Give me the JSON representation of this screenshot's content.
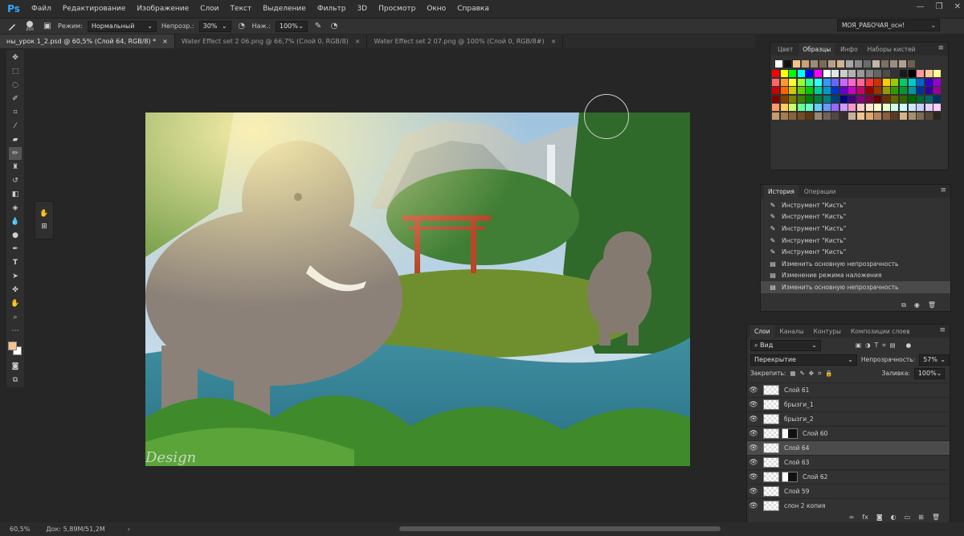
{
  "app": {
    "logo": "Ps"
  },
  "menu": [
    "Файл",
    "Редактирование",
    "Изображение",
    "Слои",
    "Текст",
    "Выделение",
    "Фильтр",
    "3D",
    "Просмотр",
    "Окно",
    "Справка"
  ],
  "window_controls": [
    "—",
    "❐",
    "✕"
  ],
  "options": {
    "brush_size": "200",
    "mode_label": "Режим:",
    "mode_value": "Нормальный",
    "opacity_label": "Непрозр.:",
    "opacity_value": "30%",
    "flow_label": "Наж.:",
    "flow_value": "100%",
    "workspace": "МОЯ_РАБОЧАЯ_осн!"
  },
  "tabs": [
    {
      "label": "ны_урок 1_2.psd @ 60,5% (Слой 64, RGB/8) *",
      "active": true
    },
    {
      "label": "Water Effect set 2 06.png @ 66,7% (Слой 0, RGB/8)",
      "active": false
    },
    {
      "label": "Water Effect set 2 07.png @ 100% (Слой 0, RGB/8#)",
      "active": false
    }
  ],
  "tab_close": "×",
  "canvas": {
    "watermark": "Design"
  },
  "swatches_panel": {
    "tabs": [
      "Цвет",
      "Образцы",
      "Инфо",
      "Наборы кистей"
    ],
    "active_tab": "Образцы",
    "recent": [
      "#ffffff",
      "#111111",
      "#f3c48f",
      "#c9a27a",
      "#9c8b7a",
      "#7a6a55",
      "#b79f86",
      "#d1b48e",
      "#a8a8a8",
      "#8a8a8a",
      "#6b6b6b",
      "#c0b8a8",
      "#7c7060",
      "#9a8f80",
      "#b0a090",
      "#6d5f4f"
    ],
    "grid": [
      "#ff0000",
      "#ffff00",
      "#00ff00",
      "#00ffff",
      "#0000ff",
      "#ff00ff",
      "#ffffff",
      "#e6e6e6",
      "#cccccc",
      "#b3b3b3",
      "#999999",
      "#808080",
      "#666666",
      "#4d4d4d",
      "#333333",
      "#1a1a1a",
      "#000000",
      "#ff9999",
      "#ffcc99",
      "#ffff99",
      "#ff6666",
      "#ff9933",
      "#ffff33",
      "#99ff33",
      "#33ff99",
      "#33ffff",
      "#3399ff",
      "#6666ff",
      "#cc66ff",
      "#ff66cc",
      "#ff6699",
      "#ff3333",
      "#cc3300",
      "#ffcc00",
      "#99cc00",
      "#00cc66",
      "#00cccc",
      "#0066cc",
      "#3300cc",
      "#9900cc",
      "#cc0000",
      "#ff6600",
      "#cccc00",
      "#66cc00",
      "#00cc00",
      "#00cc99",
      "#0099cc",
      "#0033cc",
      "#6600cc",
      "#cc00cc",
      "#cc0066",
      "#990000",
      "#993300",
      "#999900",
      "#339900",
      "#009933",
      "#009999",
      "#003399",
      "#330099",
      "#990099",
      "#800000",
      "#804000",
      "#808000",
      "#408000",
      "#008000",
      "#008040",
      "#008080",
      "#004080",
      "#000080",
      "#400080",
      "#800080",
      "#800040",
      "#660000",
      "#663300",
      "#666600",
      "#336600",
      "#006600",
      "#006633",
      "#006666",
      "#003366",
      "#ff9966",
      "#ffcc66",
      "#ccff66",
      "#66ff99",
      "#66ffcc",
      "#66ccff",
      "#6699ff",
      "#9966ff",
      "#cc99ff",
      "#ff99cc",
      "#ffcccc",
      "#ffe6cc",
      "#ffffcc",
      "#e6ffcc",
      "#ccffe6",
      "#ccffff",
      "#cce6ff",
      "#ccccff",
      "#e6ccff",
      "#ffccff",
      "#c69c6d",
      "#a67c52",
      "#8c6239",
      "#754c24",
      "#603913",
      "#998675",
      "#736357",
      "#534741",
      "#362f2d",
      "#c7b299",
      "#f3c48f",
      "#e0a96d",
      "#b5835a",
      "#8b5e3c",
      "#5c3a21",
      "#d4b483",
      "#a88f6e",
      "#7f6b52",
      "#564736",
      "#2e2519"
    ]
  },
  "history_panel": {
    "tabs": [
      "История",
      "Операции"
    ],
    "rows": [
      {
        "icon": "brush",
        "label": "Инструмент \"Кисть\""
      },
      {
        "icon": "brush",
        "label": "Инструмент \"Кисть\""
      },
      {
        "icon": "brush",
        "label": "Инструмент \"Кисть\""
      },
      {
        "icon": "brush",
        "label": "Инструмент \"Кисть\""
      },
      {
        "icon": "brush",
        "label": "Инструмент \"Кисть\""
      },
      {
        "icon": "doc",
        "label": "Изменить основную непрозрачность"
      },
      {
        "icon": "doc",
        "label": "Изменение режима наложения"
      },
      {
        "icon": "doc",
        "label": "Изменить основную непрозрачность"
      }
    ]
  },
  "layers_panel": {
    "tabs": [
      "Слои",
      "Каналы",
      "Контуры",
      "Композиции слоев"
    ],
    "filter_label": "Вид",
    "blend_mode": "Перекрытие",
    "opacity_label": "Непрозрачность:",
    "opacity_value": "57%",
    "lock_label": "Закрепить:",
    "fill_label": "Заливка:",
    "fill_value": "100%",
    "layers": [
      {
        "name": "Слой 61",
        "mask": false,
        "active": false
      },
      {
        "name": "брызги_1",
        "mask": false,
        "active": false
      },
      {
        "name": "брызги_2",
        "mask": false,
        "active": false
      },
      {
        "name": "Слой 60",
        "mask": true,
        "active": false
      },
      {
        "name": "Слой 64",
        "mask": false,
        "active": true
      },
      {
        "name": "Слой 63",
        "mask": false,
        "active": false
      },
      {
        "name": "Слой 62",
        "mask": true,
        "active": false
      },
      {
        "name": "Слой 59",
        "mask": false,
        "active": false
      },
      {
        "name": "слон 2 копия",
        "mask": false,
        "active": false
      }
    ]
  },
  "status": {
    "zoom": "60,5%",
    "doc": "Док: 5,89M/51,2M"
  }
}
